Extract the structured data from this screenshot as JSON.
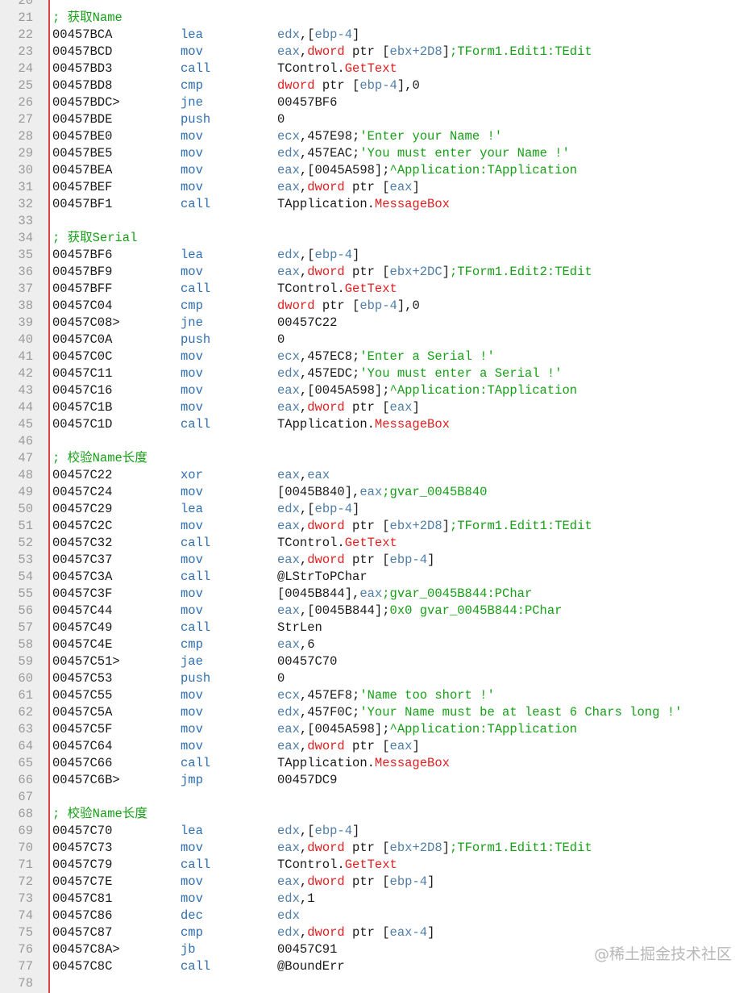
{
  "lines": [
    {
      "num": "20",
      "kind": "blank"
    },
    {
      "num": "21",
      "kind": "comment",
      "text": "; 获取Name"
    },
    {
      "num": "22",
      "kind": "code",
      "addr": "00457BCA",
      "mnem": "lea",
      "ops": [
        [
          "r",
          "edx"
        ],
        [
          "d",
          ",["
        ],
        [
          "r",
          "ebp-4"
        ],
        [
          "d",
          "]"
        ]
      ]
    },
    {
      "num": "23",
      "kind": "code",
      "addr": "00457BCD",
      "mnem": "mov",
      "ops": [
        [
          "r",
          "eax"
        ],
        [
          "d",
          ","
        ],
        [
          "k",
          "dword"
        ],
        [
          "d",
          " ptr ["
        ],
        [
          "r",
          "ebx+2D8"
        ],
        [
          "d",
          "]"
        ],
        [
          "c",
          ";TForm1.Edit1:TEdit"
        ]
      ]
    },
    {
      "num": "24",
      "kind": "code",
      "addr": "00457BD3",
      "mnem": "call",
      "ops": [
        [
          "d",
          "TControl."
        ],
        [
          "k",
          "GetText"
        ]
      ]
    },
    {
      "num": "25",
      "kind": "code",
      "addr": "00457BD8",
      "mnem": "cmp",
      "ops": [
        [
          "k",
          "dword"
        ],
        [
          "d",
          " ptr ["
        ],
        [
          "r",
          "ebp-4"
        ],
        [
          "d",
          "],0"
        ]
      ]
    },
    {
      "num": "26",
      "kind": "code",
      "addr": "00457BDC>",
      "mnem": "jne",
      "ops": [
        [
          "d",
          "00457BF6"
        ]
      ]
    },
    {
      "num": "27",
      "kind": "code",
      "addr": "00457BDE",
      "mnem": "push",
      "ops": [
        [
          "d",
          "0"
        ]
      ]
    },
    {
      "num": "28",
      "kind": "code",
      "addr": "00457BE0",
      "mnem": "mov",
      "ops": [
        [
          "r",
          "ecx"
        ],
        [
          "d",
          ",457E98;"
        ],
        [
          "c",
          "'Enter your Name !'"
        ]
      ]
    },
    {
      "num": "29",
      "kind": "code",
      "addr": "00457BE5",
      "mnem": "mov",
      "ops": [
        [
          "r",
          "edx"
        ],
        [
          "d",
          ",457EAC;"
        ],
        [
          "c",
          "'You must enter your Name !'"
        ]
      ]
    },
    {
      "num": "30",
      "kind": "code",
      "addr": "00457BEA",
      "mnem": "mov",
      "ops": [
        [
          "r",
          "eax"
        ],
        [
          "d",
          ",[0045A598];"
        ],
        [
          "c",
          "^Application:TApplication"
        ]
      ]
    },
    {
      "num": "31",
      "kind": "code",
      "addr": "00457BEF",
      "mnem": "mov",
      "ops": [
        [
          "r",
          "eax"
        ],
        [
          "d",
          ","
        ],
        [
          "k",
          "dword"
        ],
        [
          "d",
          " ptr ["
        ],
        [
          "r",
          "eax"
        ],
        [
          "d",
          "]"
        ]
      ]
    },
    {
      "num": "32",
      "kind": "code",
      "addr": "00457BF1",
      "mnem": "call",
      "ops": [
        [
          "d",
          "TApplication."
        ],
        [
          "k",
          "MessageBox"
        ]
      ]
    },
    {
      "num": "33",
      "kind": "blank"
    },
    {
      "num": "34",
      "kind": "comment",
      "text": "; 获取Serial"
    },
    {
      "num": "35",
      "kind": "code",
      "addr": "00457BF6",
      "mnem": "lea",
      "ops": [
        [
          "r",
          "edx"
        ],
        [
          "d",
          ",["
        ],
        [
          "r",
          "ebp-4"
        ],
        [
          "d",
          "]"
        ]
      ]
    },
    {
      "num": "36",
      "kind": "code",
      "addr": "00457BF9",
      "mnem": "mov",
      "ops": [
        [
          "r",
          "eax"
        ],
        [
          "d",
          ","
        ],
        [
          "k",
          "dword"
        ],
        [
          "d",
          " ptr ["
        ],
        [
          "r",
          "ebx+2DC"
        ],
        [
          "d",
          "]"
        ],
        [
          "c",
          ";TForm1.Edit2:TEdit"
        ]
      ]
    },
    {
      "num": "37",
      "kind": "code",
      "addr": "00457BFF",
      "mnem": "call",
      "ops": [
        [
          "d",
          "TControl."
        ],
        [
          "k",
          "GetText"
        ]
      ]
    },
    {
      "num": "38",
      "kind": "code",
      "addr": "00457C04",
      "mnem": "cmp",
      "ops": [
        [
          "k",
          "dword"
        ],
        [
          "d",
          " ptr ["
        ],
        [
          "r",
          "ebp-4"
        ],
        [
          "d",
          "],0"
        ]
      ]
    },
    {
      "num": "39",
      "kind": "code",
      "addr": "00457C08>",
      "mnem": "jne",
      "ops": [
        [
          "d",
          "00457C22"
        ]
      ]
    },
    {
      "num": "40",
      "kind": "code",
      "addr": "00457C0A",
      "mnem": "push",
      "ops": [
        [
          "d",
          "0"
        ]
      ]
    },
    {
      "num": "41",
      "kind": "code",
      "addr": "00457C0C",
      "mnem": "mov",
      "ops": [
        [
          "r",
          "ecx"
        ],
        [
          "d",
          ",457EC8;"
        ],
        [
          "c",
          "'Enter a Serial !'"
        ]
      ]
    },
    {
      "num": "42",
      "kind": "code",
      "addr": "00457C11",
      "mnem": "mov",
      "ops": [
        [
          "r",
          "edx"
        ],
        [
          "d",
          ",457EDC;"
        ],
        [
          "c",
          "'You must enter a Serial !'"
        ]
      ]
    },
    {
      "num": "43",
      "kind": "code",
      "addr": "00457C16",
      "mnem": "mov",
      "ops": [
        [
          "r",
          "eax"
        ],
        [
          "d",
          ",[0045A598];"
        ],
        [
          "c",
          "^Application:TApplication"
        ]
      ]
    },
    {
      "num": "44",
      "kind": "code",
      "addr": "00457C1B",
      "mnem": "mov",
      "ops": [
        [
          "r",
          "eax"
        ],
        [
          "d",
          ","
        ],
        [
          "k",
          "dword"
        ],
        [
          "d",
          " ptr ["
        ],
        [
          "r",
          "eax"
        ],
        [
          "d",
          "]"
        ]
      ]
    },
    {
      "num": "45",
      "kind": "code",
      "addr": "00457C1D",
      "mnem": "call",
      "ops": [
        [
          "d",
          "TApplication."
        ],
        [
          "k",
          "MessageBox"
        ]
      ]
    },
    {
      "num": "46",
      "kind": "blank"
    },
    {
      "num": "47",
      "kind": "comment",
      "text": "; 校验Name长度"
    },
    {
      "num": "48",
      "kind": "code",
      "addr": "00457C22",
      "mnem": "xor",
      "ops": [
        [
          "r",
          "eax"
        ],
        [
          "d",
          ","
        ],
        [
          "r",
          "eax"
        ]
      ]
    },
    {
      "num": "49",
      "kind": "code",
      "addr": "00457C24",
      "mnem": "mov",
      "ops": [
        [
          "d",
          "[0045B840],"
        ],
        [
          "r",
          "eax"
        ],
        [
          "c",
          ";gvar_0045B840"
        ]
      ]
    },
    {
      "num": "50",
      "kind": "code",
      "addr": "00457C29",
      "mnem": "lea",
      "ops": [
        [
          "r",
          "edx"
        ],
        [
          "d",
          ",["
        ],
        [
          "r",
          "ebp-4"
        ],
        [
          "d",
          "]"
        ]
      ]
    },
    {
      "num": "51",
      "kind": "code",
      "addr": "00457C2C",
      "mnem": "mov",
      "ops": [
        [
          "r",
          "eax"
        ],
        [
          "d",
          ","
        ],
        [
          "k",
          "dword"
        ],
        [
          "d",
          " ptr ["
        ],
        [
          "r",
          "ebx+2D8"
        ],
        [
          "d",
          "]"
        ],
        [
          "c",
          ";TForm1.Edit1:TEdit"
        ]
      ]
    },
    {
      "num": "52",
      "kind": "code",
      "addr": "00457C32",
      "mnem": "call",
      "ops": [
        [
          "d",
          "TControl."
        ],
        [
          "k",
          "GetText"
        ]
      ]
    },
    {
      "num": "53",
      "kind": "code",
      "addr": "00457C37",
      "mnem": "mov",
      "ops": [
        [
          "r",
          "eax"
        ],
        [
          "d",
          ","
        ],
        [
          "k",
          "dword"
        ],
        [
          "d",
          " ptr ["
        ],
        [
          "r",
          "ebp-4"
        ],
        [
          "d",
          "]"
        ]
      ]
    },
    {
      "num": "54",
      "kind": "code",
      "addr": "00457C3A",
      "mnem": "call",
      "ops": [
        [
          "d",
          "@LStrToPChar"
        ]
      ]
    },
    {
      "num": "55",
      "kind": "code",
      "addr": "00457C3F",
      "mnem": "mov",
      "ops": [
        [
          "d",
          "[0045B844],"
        ],
        [
          "r",
          "eax"
        ],
        [
          "c",
          ";gvar_0045B844:PChar"
        ]
      ]
    },
    {
      "num": "56",
      "kind": "code",
      "addr": "00457C44",
      "mnem": "mov",
      "ops": [
        [
          "r",
          "eax"
        ],
        [
          "d",
          ",[0045B844];"
        ],
        [
          "c",
          "0x0 gvar_0045B844:PChar"
        ]
      ]
    },
    {
      "num": "57",
      "kind": "code",
      "addr": "00457C49",
      "mnem": "call",
      "ops": [
        [
          "d",
          "StrLen"
        ]
      ]
    },
    {
      "num": "58",
      "kind": "code",
      "addr": "00457C4E",
      "mnem": "cmp",
      "ops": [
        [
          "r",
          "eax"
        ],
        [
          "d",
          ",6"
        ]
      ]
    },
    {
      "num": "59",
      "kind": "code",
      "addr": "00457C51>",
      "mnem": "jae",
      "ops": [
        [
          "d",
          "00457C70"
        ]
      ]
    },
    {
      "num": "60",
      "kind": "code",
      "addr": "00457C53",
      "mnem": "push",
      "ops": [
        [
          "d",
          "0"
        ]
      ]
    },
    {
      "num": "61",
      "kind": "code",
      "addr": "00457C55",
      "mnem": "mov",
      "ops": [
        [
          "r",
          "ecx"
        ],
        [
          "d",
          ",457EF8;"
        ],
        [
          "c",
          "'Name too short !'"
        ]
      ]
    },
    {
      "num": "62",
      "kind": "code",
      "addr": "00457C5A",
      "mnem": "mov",
      "ops": [
        [
          "r",
          "edx"
        ],
        [
          "d",
          ",457F0C;"
        ],
        [
          "c",
          "'Your Name must be at least 6 Chars long !'"
        ]
      ]
    },
    {
      "num": "63",
      "kind": "code",
      "addr": "00457C5F",
      "mnem": "mov",
      "ops": [
        [
          "r",
          "eax"
        ],
        [
          "d",
          ",[0045A598];"
        ],
        [
          "c",
          "^Application:TApplication"
        ]
      ]
    },
    {
      "num": "64",
      "kind": "code",
      "addr": "00457C64",
      "mnem": "mov",
      "ops": [
        [
          "r",
          "eax"
        ],
        [
          "d",
          ","
        ],
        [
          "k",
          "dword"
        ],
        [
          "d",
          " ptr ["
        ],
        [
          "r",
          "eax"
        ],
        [
          "d",
          "]"
        ]
      ]
    },
    {
      "num": "65",
      "kind": "code",
      "addr": "00457C66",
      "mnem": "call",
      "ops": [
        [
          "d",
          "TApplication."
        ],
        [
          "k",
          "MessageBox"
        ]
      ]
    },
    {
      "num": "66",
      "kind": "code",
      "addr": "00457C6B>",
      "mnem": "jmp",
      "ops": [
        [
          "d",
          "00457DC9"
        ]
      ]
    },
    {
      "num": "67",
      "kind": "blank"
    },
    {
      "num": "68",
      "kind": "comment",
      "text": "; 校验Name长度"
    },
    {
      "num": "69",
      "kind": "code",
      "addr": "00457C70",
      "mnem": "lea",
      "ops": [
        [
          "r",
          "edx"
        ],
        [
          "d",
          ",["
        ],
        [
          "r",
          "ebp-4"
        ],
        [
          "d",
          "]"
        ]
      ]
    },
    {
      "num": "70",
      "kind": "code",
      "addr": "00457C73",
      "mnem": "mov",
      "ops": [
        [
          "r",
          "eax"
        ],
        [
          "d",
          ","
        ],
        [
          "k",
          "dword"
        ],
        [
          "d",
          " ptr ["
        ],
        [
          "r",
          "ebx+2D8"
        ],
        [
          "d",
          "]"
        ],
        [
          "c",
          ";TForm1.Edit1:TEdit"
        ]
      ]
    },
    {
      "num": "71",
      "kind": "code",
      "addr": "00457C79",
      "mnem": "call",
      "ops": [
        [
          "d",
          "TControl."
        ],
        [
          "k",
          "GetText"
        ]
      ]
    },
    {
      "num": "72",
      "kind": "code",
      "addr": "00457C7E",
      "mnem": "mov",
      "ops": [
        [
          "r",
          "eax"
        ],
        [
          "d",
          ","
        ],
        [
          "k",
          "dword"
        ],
        [
          "d",
          " ptr ["
        ],
        [
          "r",
          "ebp-4"
        ],
        [
          "d",
          "]"
        ]
      ]
    },
    {
      "num": "73",
      "kind": "code",
      "addr": "00457C81",
      "mnem": "mov",
      "ops": [
        [
          "r",
          "edx"
        ],
        [
          "d",
          ",1"
        ]
      ]
    },
    {
      "num": "74",
      "kind": "code",
      "addr": "00457C86",
      "mnem": "dec",
      "ops": [
        [
          "r",
          "edx"
        ]
      ]
    },
    {
      "num": "75",
      "kind": "code",
      "addr": "00457C87",
      "mnem": "cmp",
      "ops": [
        [
          "r",
          "edx"
        ],
        [
          "d",
          ","
        ],
        [
          "k",
          "dword"
        ],
        [
          "d",
          " ptr ["
        ],
        [
          "r",
          "eax-4"
        ],
        [
          "d",
          "]"
        ]
      ]
    },
    {
      "num": "76",
      "kind": "code",
      "addr": "00457C8A>",
      "mnem": "jb",
      "ops": [
        [
          "d",
          "00457C91"
        ]
      ]
    },
    {
      "num": "77",
      "kind": "code",
      "addr": "00457C8C",
      "mnem": "call",
      "ops": [
        [
          "d",
          "@BoundErr"
        ]
      ]
    },
    {
      "num": "78",
      "kind": "blank"
    }
  ],
  "watermark": "@稀土掘金技术社区",
  "colors": {
    "gutter_bg": "#eeeeee",
    "gutter_line": "#e04040",
    "comment": "#17a017",
    "mnemonic": "#2f6fb0",
    "register": "#4f7ea8",
    "keyword": "#e02020",
    "default_text": "#1a1a1a",
    "line_number": "#9a9a9a"
  }
}
